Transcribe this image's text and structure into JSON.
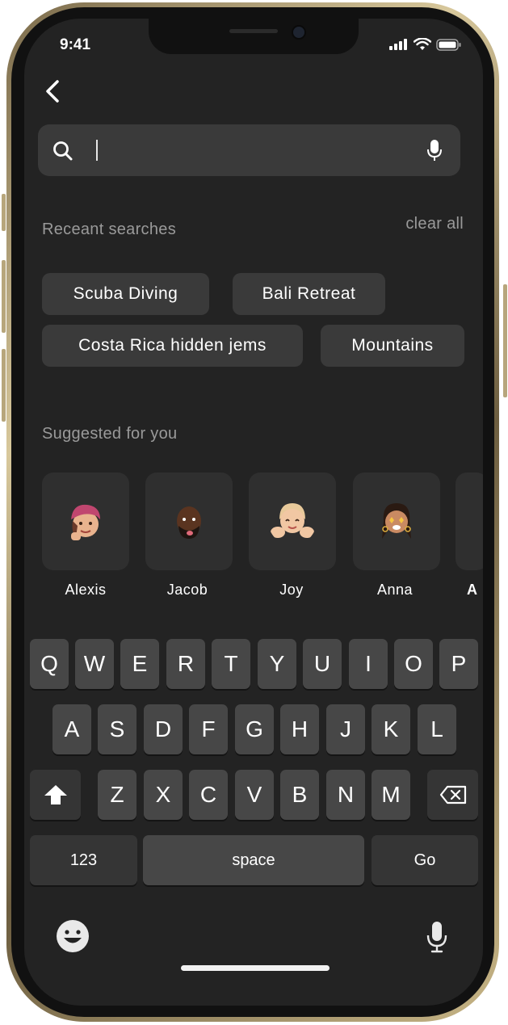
{
  "status_bar": {
    "time": "9:41"
  },
  "search": {
    "value": "",
    "placeholder": ""
  },
  "recent": {
    "title": "Receant searches",
    "clear_label": "clear all",
    "chips": [
      "Scuba Diving",
      "Bali Retreat",
      "Costa Rica hidden jems",
      "Mountains"
    ]
  },
  "suggested": {
    "title": "Suggested for you",
    "people": [
      "Alexis",
      "Jacob",
      "Joy",
      "Anna",
      "A"
    ]
  },
  "keyboard": {
    "row1": [
      "Q",
      "W",
      "E",
      "R",
      "T",
      "Y",
      "U",
      "I",
      "O",
      "P"
    ],
    "row2": [
      "A",
      "S",
      "D",
      "F",
      "G",
      "H",
      "J",
      "K",
      "L"
    ],
    "row3": [
      "Z",
      "X",
      "C",
      "V",
      "B",
      "N",
      "M"
    ],
    "numbers_label": "123",
    "space_label": "space",
    "go_label": "Go"
  },
  "colors": {
    "background": "#232323",
    "surface": "#3a3a3a",
    "key": "#474747",
    "muted_text": "#9a9a9a"
  },
  "icons": [
    "back-chevron-icon",
    "search-icon",
    "microphone-icon",
    "shift-icon",
    "backspace-icon",
    "emoji-icon",
    "dictation-mic-icon",
    "signal-icon",
    "wifi-icon",
    "battery-icon"
  ]
}
